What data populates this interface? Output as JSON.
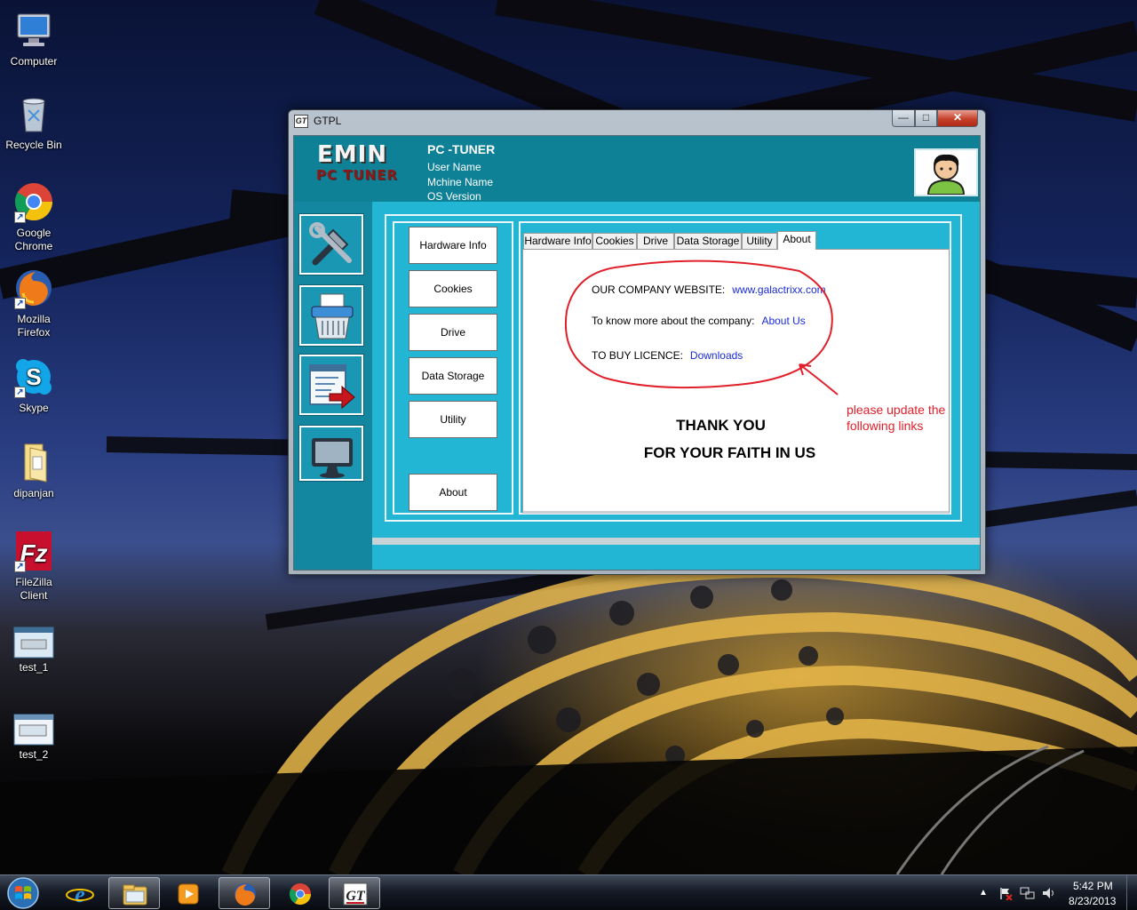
{
  "desktop": {
    "icons": [
      {
        "label": "Computer",
        "icon": "computer-icon"
      },
      {
        "label": "Recycle Bin",
        "icon": "recycle-bin-icon"
      },
      {
        "label": "Google Chrome",
        "icon": "chrome-icon"
      },
      {
        "label": "Mozilla Firefox",
        "icon": "firefox-icon"
      },
      {
        "label": "Skype",
        "icon": "skype-icon"
      },
      {
        "label": "dipanjan",
        "icon": "folder-icon"
      },
      {
        "label": "FileZilla Client",
        "icon": "filezilla-icon"
      },
      {
        "label": "test_1",
        "icon": "app-window-icon"
      },
      {
        "label": "test_2",
        "icon": "app-window-icon"
      }
    ]
  },
  "window": {
    "title": "GTPL",
    "title_logo": "GT",
    "controls": {
      "minimize": "—",
      "maximize": "□",
      "close": "✕"
    },
    "header": {
      "brand_top": "EMIN",
      "brand_bottom": "PC TUNER",
      "app_title": "PC -TUNER",
      "user_name_label": "User Name",
      "machine_name_label": "Mchine Name",
      "os_version_label": "OS Version"
    },
    "left_tools": [
      "tools-icon",
      "shredder-icon",
      "export-icon",
      "monitor-icon"
    ],
    "side_buttons": [
      "Hardware Info",
      "Cookies",
      "Drive",
      "Data Storage",
      "Utility",
      "About"
    ],
    "tabs": [
      "Hardware Info",
      "Cookies",
      "Drive",
      "Data Storage",
      "Utility",
      "About"
    ],
    "active_tab": "About",
    "about": {
      "website_label": "OUR COMPANY WEBSITE:",
      "website_link": "www.galactrixx.com",
      "company_label": "To know more about the company:",
      "company_link": "About Us",
      "licence_label": "TO BUY LICENCE:",
      "licence_link": "Downloads",
      "thanks_1": "THANK YOU",
      "thanks_2": "FOR YOUR FAITH IN US"
    }
  },
  "annotation": {
    "note": "please update the following links",
    "color": "#e0202a"
  },
  "taskbar": {
    "items": [
      "start-orb",
      "internet-explorer-icon",
      "windows-explorer-icon",
      "media-player-icon",
      "firefox-icon",
      "chrome-icon",
      "gt-app-icon"
    ],
    "active_item": "gt-app-icon",
    "clock_time": "5:42 PM",
    "clock_date": "8/23/2013"
  }
}
